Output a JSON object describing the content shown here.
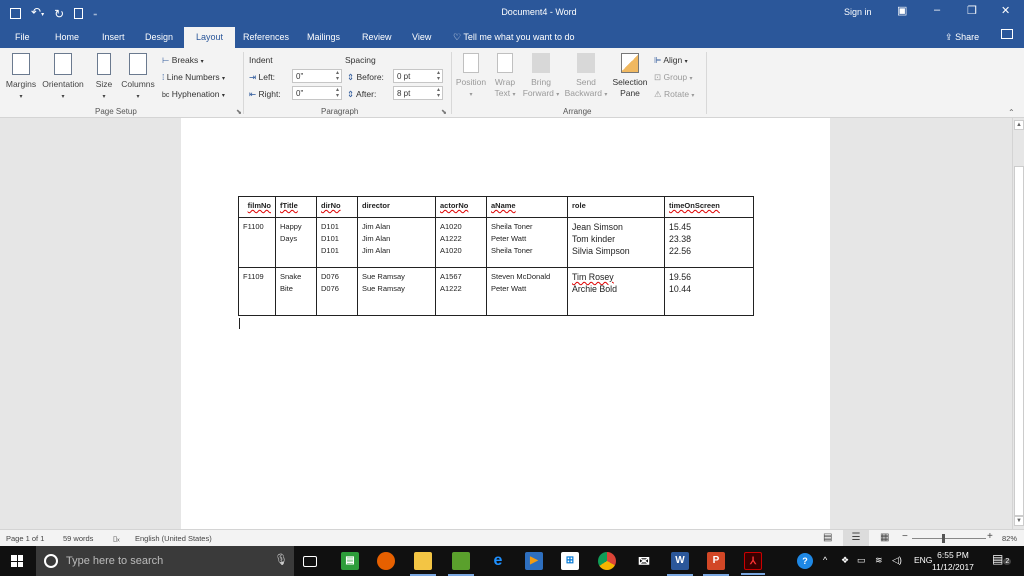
{
  "window": {
    "title": "Document4 - Word",
    "sign_in": "Sign in",
    "qat": {
      "save_icon": "save-icon",
      "undo_icon": "undo-icon",
      "redo_icon": "redo-icon",
      "new_icon": "new-document-icon",
      "customize_icon": "customize-qat-icon"
    },
    "controls": {
      "ribbon_display": "▣",
      "minimize": "–",
      "restore": "❐",
      "close": "✕"
    }
  },
  "tabs": [
    {
      "label": "File",
      "active": false
    },
    {
      "label": "Home",
      "active": false
    },
    {
      "label": "Insert",
      "active": false
    },
    {
      "label": "Design",
      "active": false
    },
    {
      "label": "Layout",
      "active": true
    },
    {
      "label": "References",
      "active": false
    },
    {
      "label": "Mailings",
      "active": false
    },
    {
      "label": "Review",
      "active": false
    },
    {
      "label": "View",
      "active": false
    }
  ],
  "tell_me": "Tell me what you want to do",
  "share": "Share",
  "ribbon": {
    "page_setup": {
      "label": "Page Setup",
      "margins": "Margins",
      "orientation": "Orientation",
      "size": "Size",
      "columns": "Columns",
      "breaks": "Breaks",
      "line_numbers": "Line Numbers",
      "hyphenation": "Hyphenation"
    },
    "paragraph": {
      "label": "Paragraph",
      "indent": "Indent",
      "spacing": "Spacing",
      "left_label": "Left:",
      "left_value": "0\"",
      "right_label": "Right:",
      "right_value": "0\"",
      "before_label": "Before:",
      "before_value": "0 pt",
      "after_label": "After:",
      "after_value": "8 pt"
    },
    "arrange": {
      "label": "Arrange",
      "position": "Position",
      "wrap_text_1": "Wrap",
      "wrap_text_2": "Text",
      "bring_forward_1": "Bring",
      "bring_forward_2": "Forward",
      "send_backward_1": "Send",
      "send_backward_2": "Backward",
      "selection_pane_1": "Selection",
      "selection_pane_2": "Pane",
      "align": "Align",
      "group": "Group",
      "rotate": "Rotate"
    }
  },
  "table": {
    "headers": [
      "filmNo",
      "fTitle",
      "dirNo",
      "director",
      "actorNo",
      "aName",
      "role",
      "timeOnScreen"
    ],
    "rows": [
      {
        "filmNo": "F1100",
        "fTitle": [
          "Happy",
          "Days"
        ],
        "dirNo": [
          "D101",
          "D101",
          "D101"
        ],
        "director": [
          "Jim Alan",
          "Jim Alan",
          "Jim Alan"
        ],
        "actorNo": [
          "A1020",
          "A1222",
          "A1020"
        ],
        "aName": [
          "Sheila Toner",
          "Peter Watt",
          "Sheila Toner"
        ],
        "role": [
          "Jean Simson",
          "Tom kinder",
          "Silvia Simpson"
        ],
        "timeOnScreen": [
          "15.45",
          "23.38",
          "22.56"
        ]
      },
      {
        "filmNo": "F1109",
        "fTitle": [
          "Snake",
          "Bite"
        ],
        "dirNo": [
          "D076",
          "D076"
        ],
        "director": [
          "Sue Ramsay",
          "Sue Ramsay"
        ],
        "actorNo": [
          "A1567",
          "A1222"
        ],
        "aName": [
          "Steven McDonald",
          "Peter Watt"
        ],
        "role": [
          "Tim Rosey",
          "Archie Bold"
        ],
        "timeOnScreen": [
          "19.56",
          "10.44"
        ]
      }
    ]
  },
  "status": {
    "page": "Page 1 of 1",
    "words": "59 words",
    "language": "English (United States)",
    "zoom": "82%",
    "zoom_fraction": 0.41
  },
  "taskbar": {
    "search_placeholder": "Type here to search",
    "time": "6:55 PM",
    "date": "11/12/2017",
    "lang": "ENG",
    "notifications": "2",
    "apps": [
      "task-view",
      "evernote",
      "firefox",
      "file-explorer",
      "green-app",
      "edge",
      "media-player",
      "store",
      "chrome",
      "mail",
      "word",
      "powerpoint",
      "acrobat"
    ]
  }
}
